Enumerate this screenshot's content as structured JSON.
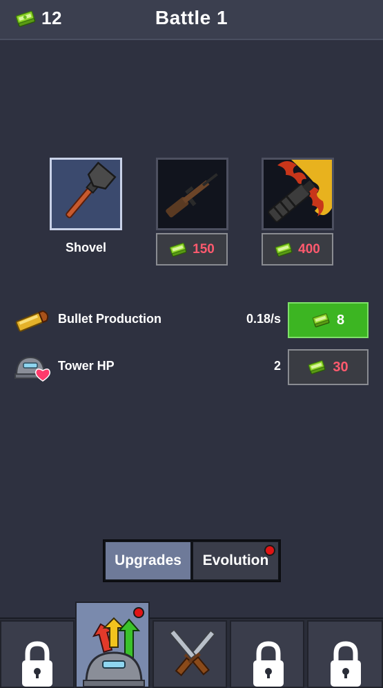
{
  "header": {
    "cash": "12",
    "title": "Battle 1",
    "cash_icon": "cash-stack-icon"
  },
  "weapons": [
    {
      "name": "Shovel",
      "owned": true,
      "icon": "shovel-icon"
    },
    {
      "price": "150",
      "owned": false,
      "icon": "rifle-icon"
    },
    {
      "price": "400",
      "owned": false,
      "icon": "flamethrower-icon"
    }
  ],
  "upgrades": [
    {
      "label": "Bullet Production",
      "value": "0.18/s",
      "cost": "8",
      "affordable": true,
      "icon": "bullet-icon"
    },
    {
      "label": "Tower HP",
      "value": "2",
      "cost": "30",
      "affordable": false,
      "icon": "tower-heart-icon"
    }
  ],
  "tabs": [
    {
      "label": "Upgrades",
      "active": true
    },
    {
      "label": "Evolution",
      "active": false,
      "notification": true
    }
  ],
  "nav": [
    {
      "icon": "lock-icon",
      "locked": true
    },
    {
      "icon": "upgrades-tower-icon",
      "active": true,
      "notification": true
    },
    {
      "icon": "crossed-knives-icon",
      "locked": false
    },
    {
      "icon": "lock-icon",
      "locked": true
    },
    {
      "icon": "lock-icon",
      "locked": true
    }
  ],
  "colors": {
    "background": "#2e3140",
    "buy_green": "#3cb522",
    "price_red": "#ff5a6e",
    "active_tab": "#6e7a99",
    "active_nav": "#7a8aad"
  }
}
